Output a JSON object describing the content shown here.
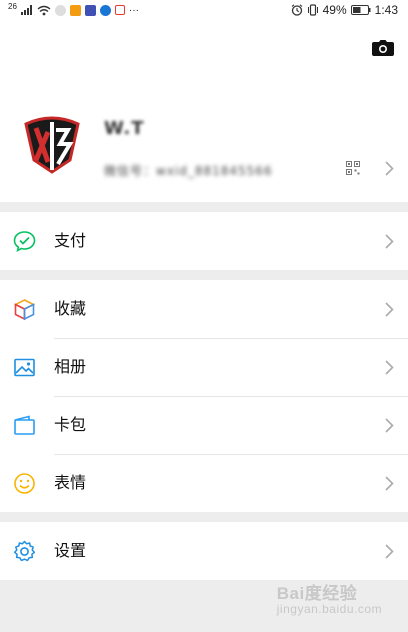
{
  "status_bar": {
    "network": "26",
    "battery": "49%",
    "time": "1:43",
    "more": "···"
  },
  "profile": {
    "nickname": "W.T",
    "wechat_id": "微信号：wxid_881845566"
  },
  "menu": {
    "pay": "支付",
    "favorites": "收藏",
    "album": "相册",
    "cards": "卡包",
    "stickers": "表情",
    "settings": "设置"
  },
  "watermark": {
    "brand": "Bai度经验",
    "url": "jingyan.baidu.com"
  },
  "icons": {
    "pay": "wechat-pay-icon",
    "favorites": "cube-icon",
    "album": "picture-icon",
    "cards": "wallet-icon",
    "stickers": "smile-icon",
    "settings": "gear-icon"
  },
  "colors": {
    "pay": "#07c160",
    "favorites_a": "#f6a623",
    "favorites_b": "#4a90e2",
    "favorites_c": "#e64340",
    "album": "#1e8fe1",
    "cards": "#2a9df4",
    "stickers": "#f7b500",
    "settings": "#1e8fe1",
    "background": "#ededed"
  }
}
